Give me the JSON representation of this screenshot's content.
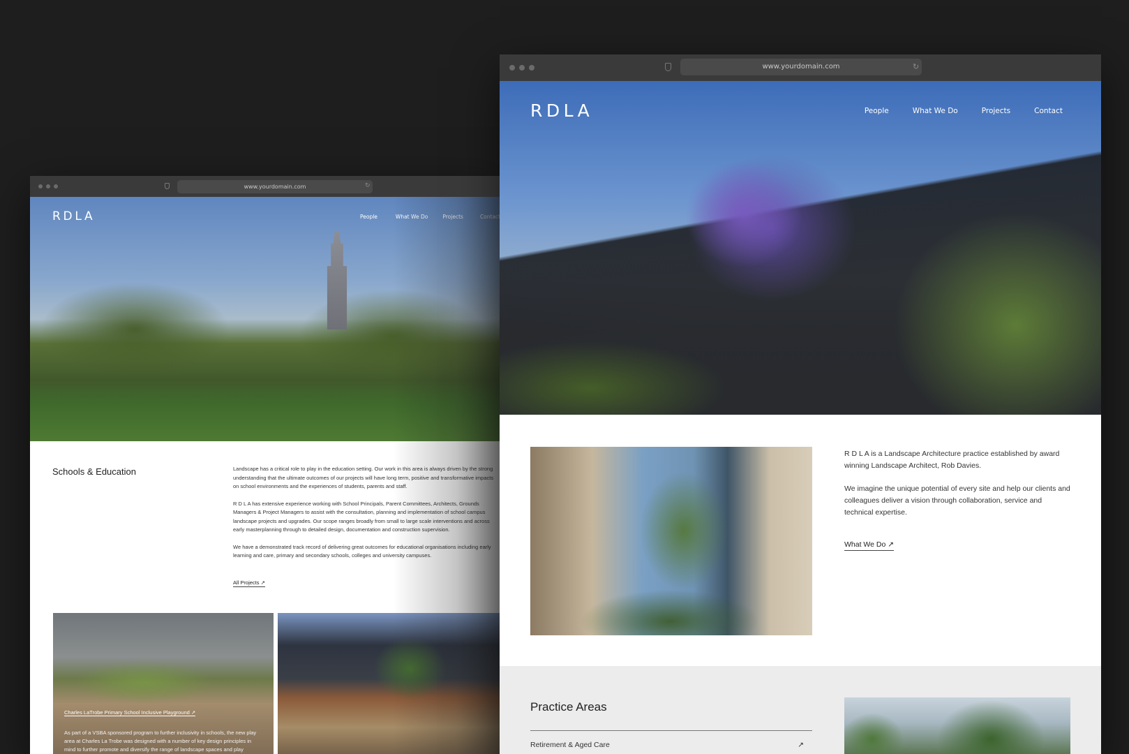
{
  "browser": {
    "url": "www.yourdomain.com"
  },
  "window_front": {
    "logo": "RDLA",
    "nav": [
      "People",
      "What We Do",
      "Projects",
      "Contact"
    ],
    "intro": {
      "p1": "R D L A is a Landscape Architecture practice established by award winning Landscape Architect, Rob Davies.",
      "p2": "We imagine the unique potential of every site and help our clients and colleagues deliver a vision through collaboration, service and technical expertise.",
      "link": "What We Do"
    },
    "practice_areas": {
      "title": "Practice Areas",
      "items": [
        "Retirement & Aged Care"
      ]
    }
  },
  "window_back": {
    "logo": "RDLA",
    "nav": [
      "People",
      "What We Do",
      "Projects",
      "Contact"
    ],
    "section_title": "Schools & Education",
    "paragraphs": [
      "Landscape has a critical role to play in the education setting. Our work in this area is always driven by the strong understanding that the ultimate outcomes of our projects will have long term, positive and transformative impacts on school environments and the experiences of students, parents and staff.",
      "R D L A has extensive experience working with School Principals, Parent Committees, Architects, Grounds Managers & Project Managers to assist with the consultation, planning and implementation of school campus landscape projects and upgrades. Our scope ranges broadly from small to large scale interventions and across early masterplanning through to detailed design, documentation and construction supervision.",
      "We have a demonstrated track record of delivering great outcomes for educational organisations including early learning and care, primary and secondary schools, colleges and university campuses."
    ],
    "link": "All Projects",
    "tiles": [
      {
        "caption": "Charles LaTrobe Primary School Inclusive Playground",
        "text": "As part of a VSBA sponsored program to further inclusivity in schools, the new play area at Charles La Trobe was designed with a number of key design principles in mind to further promote and diversify the range of landscape spaces and play"
      }
    ]
  },
  "icons": {
    "arrow": "↗",
    "reload": "↻"
  }
}
